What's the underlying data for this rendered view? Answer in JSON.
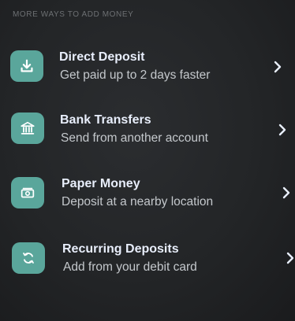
{
  "section": {
    "header": "MORE WAYS TO ADD MONEY"
  },
  "items": [
    {
      "title": "Direct Deposit",
      "subtitle": "Get paid up to 2 days faster",
      "icon": "download-icon"
    },
    {
      "title": "Bank Transfers",
      "subtitle": "Send from another account",
      "icon": "bank-icon"
    },
    {
      "title": "Paper Money",
      "subtitle": "Deposit at a nearby location",
      "icon": "cash-bill-icon"
    },
    {
      "title": "Recurring Deposits",
      "subtitle": "Add from your debit card",
      "icon": "recurring-icon"
    }
  ],
  "colors": {
    "accent": "#5aa69b",
    "background": "#232527",
    "title": "#e8eefb",
    "subtitle": "#c4c8cc",
    "header": "#6d7073"
  }
}
